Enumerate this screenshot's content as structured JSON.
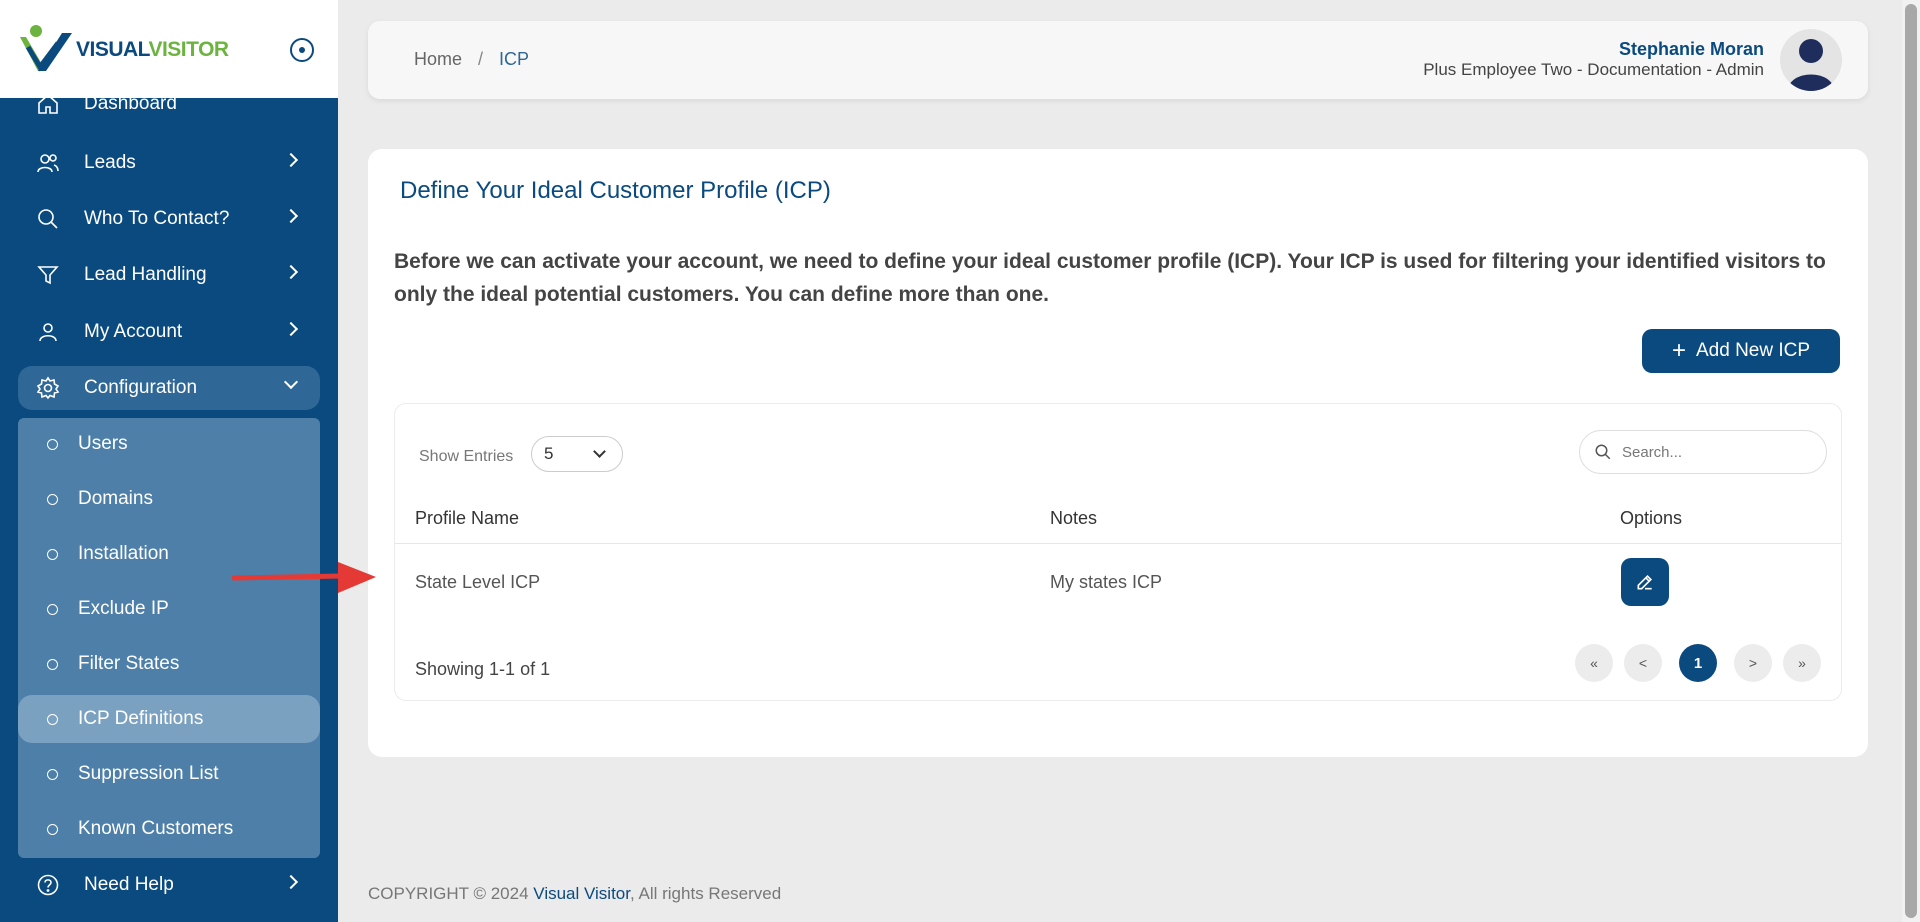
{
  "logo": {
    "text_part1": "VISUAL",
    "text_part2": "VISITOR"
  },
  "sidebar": {
    "items": [
      {
        "label": "Dashboard",
        "icon": "home-icon"
      },
      {
        "label": "Leads",
        "icon": "users-icon"
      },
      {
        "label": "Who To Contact?",
        "icon": "search-icon"
      },
      {
        "label": "Lead Handling",
        "icon": "filter-icon"
      },
      {
        "label": "My Account",
        "icon": "user-icon"
      },
      {
        "label": "Configuration",
        "icon": "gear-icon"
      },
      {
        "label": "Need Help",
        "icon": "help-icon"
      }
    ],
    "config_submenu": [
      "Users",
      "Domains",
      "Installation",
      "Exclude IP",
      "Filter States",
      "ICP Definitions",
      "Suppression List",
      "Known Customers"
    ]
  },
  "header": {
    "breadcrumb_home": "Home",
    "breadcrumb_sep": "/",
    "breadcrumb_current": "ICP",
    "user_name": "Stephanie Moran",
    "user_role": "Plus Employee Two - Documentation - Admin"
  },
  "main": {
    "title": "Define Your Ideal Customer Profile (ICP)",
    "description": "Before we can activate your account, we need to define your ideal customer profile (ICP). Your ICP is used for filtering your identified visitors to only the ideal potential customers. You can define more than one.",
    "add_button_label": "Add New ICP",
    "show_entries_label": "Show Entries",
    "entries_value": "5",
    "search_placeholder": "Search...",
    "columns": [
      "Profile Name",
      "Notes",
      "Options"
    ],
    "rows": [
      {
        "profile_name": "State Level ICP",
        "notes": "My states ICP"
      }
    ],
    "showing_text": "Showing 1-1 of 1",
    "pagination": [
      "«",
      "<",
      "1",
      ">",
      "»"
    ]
  },
  "footer": {
    "prefix": "COPYRIGHT © 2024 ",
    "brand": "Visual Visitor",
    "suffix": ", All rights Reserved"
  },
  "colors": {
    "sidebar_bg": "#0b4a7e",
    "accent": "#0b4a7e",
    "annotation_arrow": "#e53935"
  }
}
